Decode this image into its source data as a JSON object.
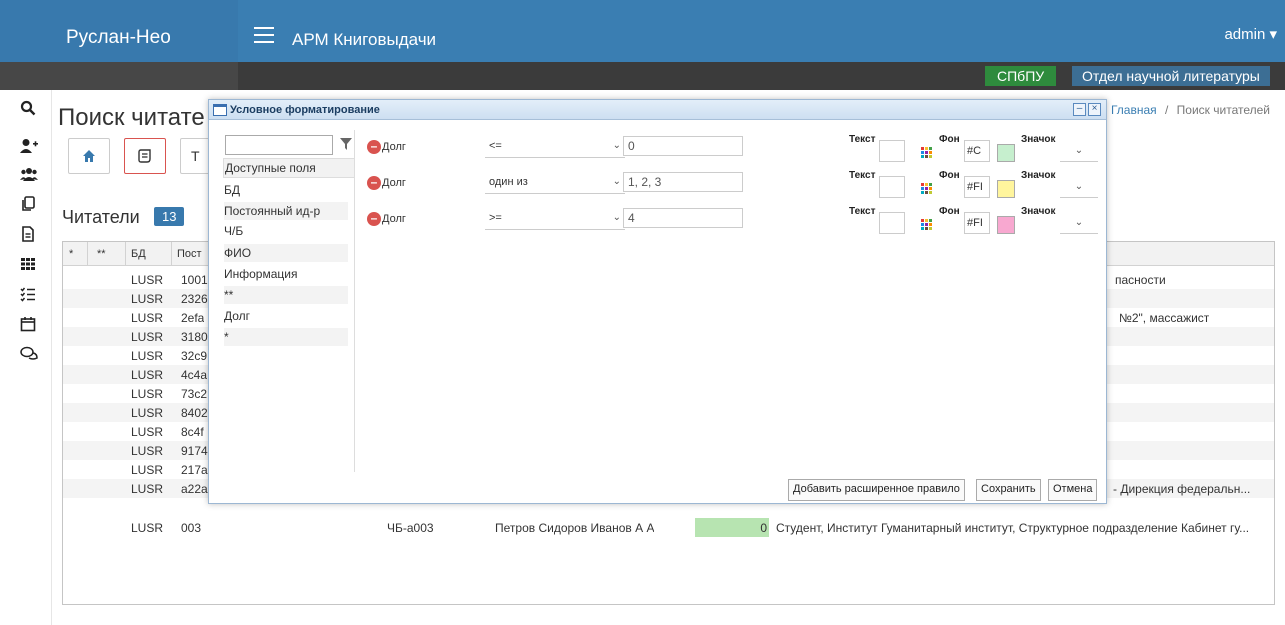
{
  "app": {
    "brand": "Руслан-Нео",
    "title": "АРМ Книговыдачи",
    "user": "admin",
    "org": "СПбПУ",
    "department": "Отдел научной литературы"
  },
  "page": {
    "title": "Поиск читате",
    "breadcrumb_home": "Главная",
    "breadcrumb_sep": "/",
    "breadcrumb_current": "Поиск читателей",
    "tool_label_t": "Т"
  },
  "readers": {
    "title": "Читатели",
    "count": "13",
    "columns": [
      "*",
      "**",
      "БД",
      "Пост"
    ],
    "rows": [
      {
        "db": "LUSR",
        "id": "1001",
        "tail": "пасности"
      },
      {
        "db": "LUSR",
        "id": "2326",
        "tail": ""
      },
      {
        "db": "LUSR",
        "id": "2efa",
        "tail": "№2\", массажист"
      },
      {
        "db": "LUSR",
        "id": "3180",
        "tail": ""
      },
      {
        "db": "LUSR",
        "id": "32c9",
        "tail": ""
      },
      {
        "db": "LUSR",
        "id": "4c4a",
        "tail": ""
      },
      {
        "db": "LUSR",
        "id": "73c2",
        "tail": ""
      },
      {
        "db": "LUSR",
        "id": "8402",
        "tail": ""
      },
      {
        "db": "LUSR",
        "id": "8c4f",
        "tail": ""
      },
      {
        "db": "LUSR",
        "id": "9174",
        "tail": ""
      },
      {
        "db": "LUSR",
        "id": "217a",
        "tail": ""
      },
      {
        "db": "LUSR",
        "id": "a22a",
        "tail": "- Дирекция федеральн..."
      }
    ],
    "last_row": {
      "db": "LUSR",
      "id": "003",
      "card": "ЧБ-а003",
      "fio": "Петров Сидоров Иванов А А",
      "debt": "0",
      "info": "Студент, Институт Гуманитарный институт, Структурное подразделение Кабинет гу..."
    }
  },
  "dialog": {
    "title": "Условное форматирование",
    "fields_header": "Доступные поля",
    "fields": [
      "БД",
      "Постоянный ид-р",
      "Ч/Б",
      "ФИО",
      "Информация",
      "**",
      "Долг",
      "*"
    ],
    "rules": [
      {
        "field": "Долг",
        "operator": "<=",
        "value": "0",
        "bg_text": "#C",
        "bg_color": "#c6efce"
      },
      {
        "field": "Долг",
        "operator": "один из",
        "value": "1, 2, 3",
        "bg_text": "#FI",
        "bg_color": "#fff59d"
      },
      {
        "field": "Долг",
        "operator": ">=",
        "value": "4",
        "bg_text": "#FI",
        "bg_color": "#f8a8d0"
      }
    ],
    "label_text": "Текст",
    "label_bg": "Фон",
    "label_icon": "Значок",
    "btn_add_rule": "Добавить расширенное правило",
    "btn_save": "Сохранить",
    "btn_cancel": "Отмена"
  }
}
